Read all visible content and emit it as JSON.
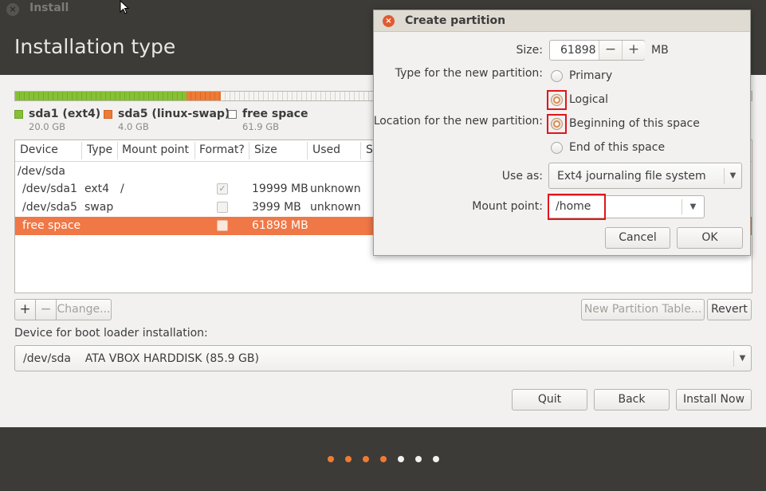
{
  "window": {
    "title": "Install",
    "close_glyph": "×"
  },
  "page_title": "Installation type",
  "partition_bar": [
    {
      "name": "sda1 (ext4)",
      "size": "20.0 GB",
      "color": "#86c034",
      "fraction": 0.2328
    },
    {
      "name": "sda5 (linux-swap)",
      "size": "4.0 GB",
      "color": "#ee7b34",
      "fraction": 0.0466
    },
    {
      "name": "free space",
      "size": "61.9 GB",
      "color": "#ffffff",
      "fraction": 0.7206
    }
  ],
  "table": {
    "headers": [
      "Device",
      "Type",
      "Mount point",
      "Format?",
      "Size",
      "Used",
      "S"
    ],
    "rows": [
      {
        "device": "/dev/sda",
        "type": "",
        "mount": "",
        "format": null,
        "size": "",
        "used": "",
        "selected": false
      },
      {
        "device": "/dev/sda1",
        "type": "ext4",
        "mount": "/",
        "format": true,
        "size": "19999 MB",
        "used": "unknown",
        "selected": false
      },
      {
        "device": "/dev/sda5",
        "type": "swap",
        "mount": "",
        "format": false,
        "size": "3999 MB",
        "used": "unknown",
        "selected": false
      },
      {
        "device": "free space",
        "type": "",
        "mount": "",
        "format": false,
        "size": "61898 MB",
        "used": "",
        "selected": true
      }
    ]
  },
  "table_buttons": {
    "add": "+",
    "remove": "−",
    "change": "Change...",
    "new_table": "New Partition Table...",
    "revert": "Revert"
  },
  "boot_loader": {
    "label": "Device for boot loader installation:",
    "device": "/dev/sda",
    "description": "ATA VBOX HARDDISK (85.9 GB)"
  },
  "nav_buttons": {
    "quit": "Quit",
    "back": "Back",
    "install": "Install Now"
  },
  "progress_dots": [
    {
      "color": "#ee7b34"
    },
    {
      "color": "#ee7b34"
    },
    {
      "color": "#ee7b34"
    },
    {
      "color": "#ee7b34"
    },
    {
      "color": "#f2f1f0"
    },
    {
      "color": "#f2f1f0"
    },
    {
      "color": "#f2f1f0"
    }
  ],
  "dialog": {
    "title": "Create partition",
    "close_glyph": "×",
    "size_label": "Size:",
    "size_value": "61898",
    "size_unit": "MB",
    "minus": "−",
    "plus": "+",
    "type_label": "Type for the new partition:",
    "type_options": [
      "Primary",
      "Logical"
    ],
    "type_selected": "Logical",
    "location_label": "Location for the new partition:",
    "location_options": [
      "Beginning of this space",
      "End of this space"
    ],
    "location_selected": "Beginning of this space",
    "use_as_label": "Use as:",
    "use_as_value": "Ext4 journaling file system",
    "mount_label": "Mount point:",
    "mount_value": "/home",
    "cancel": "Cancel",
    "ok": "OK"
  },
  "icons": {
    "dropdown": "▼"
  },
  "colors": {
    "accent": "#f07746",
    "header_bg": "#3c3b37",
    "highlight_box": "#e0161b"
  }
}
